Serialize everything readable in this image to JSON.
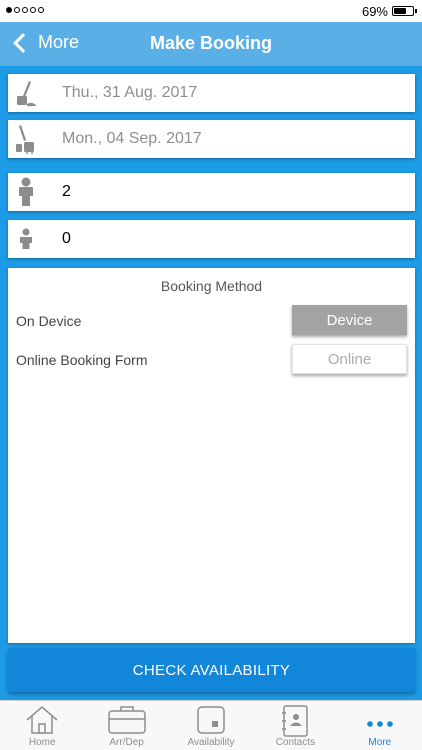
{
  "status_bar": {
    "battery": "69%",
    "battery_level": 0.69
  },
  "nav": {
    "back_label": "More",
    "title": "Make Booking"
  },
  "fields": {
    "arrival_date": "Thu., 31 Aug. 2017",
    "departure_date": "Mon., 04 Sep. 2017",
    "adults": "2",
    "children": "0"
  },
  "booking": {
    "title": "Booking Method",
    "on_device_label": "On Device",
    "device_button": "Device",
    "online_label": "Online Booking Form",
    "online_button": "Online"
  },
  "check_button": "CHECK AVAILABILITY",
  "tabs": [
    {
      "label": "Home",
      "icon": "home-icon"
    },
    {
      "label": "Arr/Dep",
      "icon": "suitcase-icon"
    },
    {
      "label": "Availability",
      "icon": "availability-icon"
    },
    {
      "label": "Contacts",
      "icon": "contacts-icon"
    },
    {
      "label": "More",
      "icon": "more-icon",
      "active": true
    }
  ],
  "colors": {
    "background": "#1e9be6",
    "nav": "#5aafe6",
    "accent": "#1286d9",
    "icon_gray": "#8c8c8c"
  }
}
